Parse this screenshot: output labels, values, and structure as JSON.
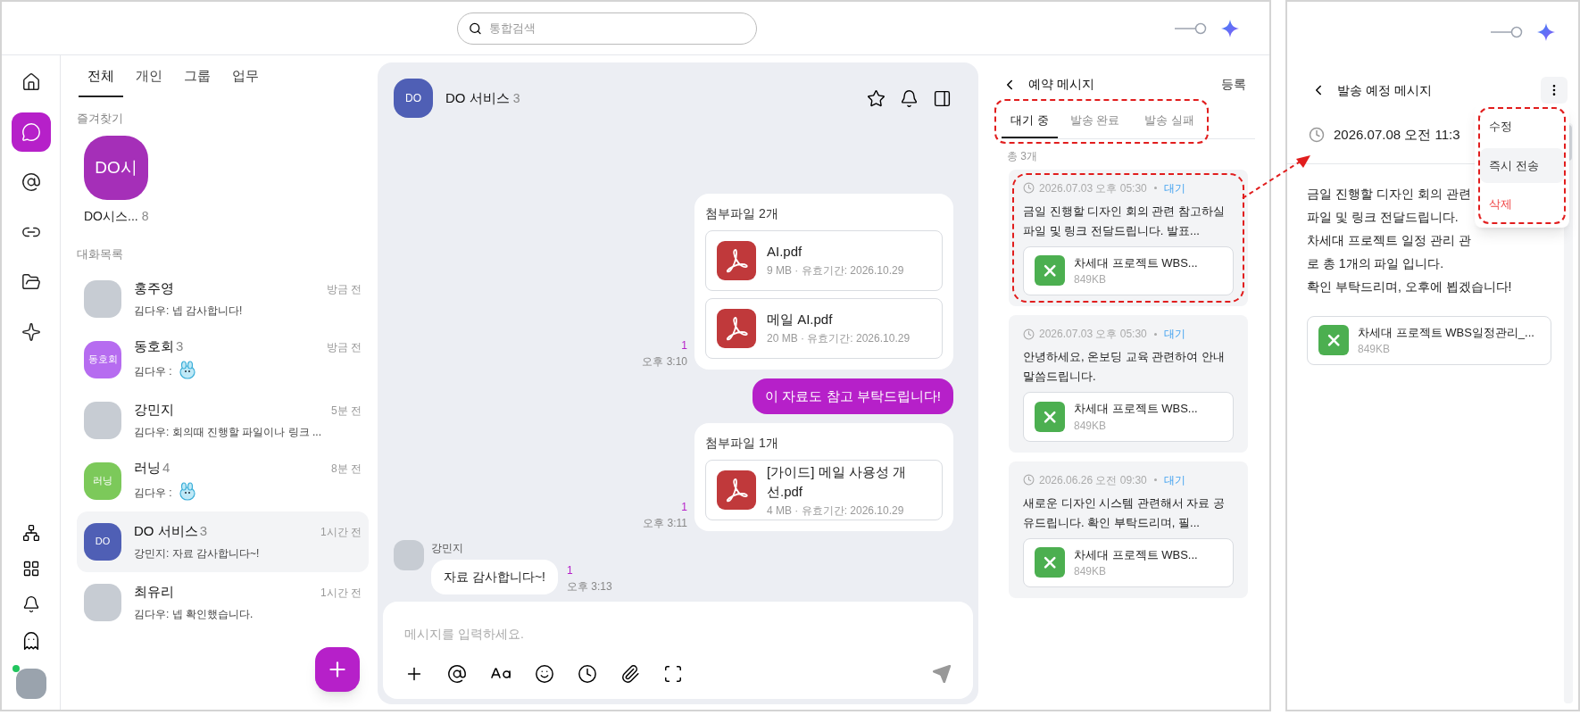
{
  "top_bar": {
    "search": {
      "placeholder": "통합검색"
    }
  },
  "nav": {
    "items": [
      {
        "selected": false
      },
      {
        "selected": true
      },
      {
        "selected": false
      },
      {
        "selected": false
      },
      {
        "selected": false
      },
      {
        "selected": false
      }
    ],
    "user": {
      "online": true
    }
  },
  "list": {
    "tabs": [
      {
        "label": "전체",
        "selected": true
      },
      {
        "label": "개인",
        "selected": false
      },
      {
        "label": "그룹",
        "selected": false
      },
      {
        "label": "업무",
        "selected": false
      }
    ],
    "favorites": {
      "heading": "즐겨찾기",
      "items": [
        {
          "avatar_text": "DO시",
          "color": "#a52fb8",
          "name": "DO시스...",
          "count": "8"
        }
      ]
    },
    "conversations": {
      "heading": "대화목록",
      "items": [
        {
          "kind": "photo",
          "name": "홍주영",
          "time": "방금 전",
          "preview": "김다우: 넵 감사합니다!",
          "sticker": false,
          "selected": false
        },
        {
          "kind": "initials",
          "avatar_text": "동호회",
          "color": "#b66cf0",
          "name": "동호회",
          "count": "3",
          "time": "방금 전",
          "preview": "김다우 :",
          "sticker": true,
          "selected": false
        },
        {
          "kind": "photo",
          "name": "강민지",
          "time": "5분 전",
          "preview": "김다우: 회의때 진행할 파일이나 링크 ...",
          "sticker": false,
          "selected": false
        },
        {
          "kind": "initials",
          "avatar_text": "러닝",
          "color": "#7cc95a",
          "name": "러닝",
          "count": "4",
          "time": "8분 전",
          "preview": "김다우 :",
          "sticker": true,
          "selected": false
        },
        {
          "kind": "initials",
          "avatar_text": "DO",
          "color": "#4f5fb5",
          "name": "DO 서비스",
          "count": "3",
          "time": "1시간 전",
          "preview": "강민지: 자료 감사합니다~!",
          "sticker": false,
          "selected": true
        },
        {
          "kind": "photo",
          "name": "최유리",
          "time": "1시간 전",
          "preview": "김다우: 넵 확인했습니다.",
          "sticker": false,
          "selected": false
        }
      ]
    }
  },
  "chat": {
    "header": {
      "avatar_text": "DO",
      "color": "#4f5fb5",
      "title": "DO 서비스",
      "count": "3"
    },
    "messages": [
      {
        "kind": "attachments",
        "title": "첨부파일 2개",
        "files": [
          {
            "name": "AI.pdf",
            "meta": "9 MB · 유효기간: 2026.10.29"
          },
          {
            "name": "메일 AI.pdf",
            "meta": "20 MB · 유효기간: 2026.10.29"
          }
        ],
        "unread": "1",
        "time": "오후 3:10"
      },
      {
        "kind": "text",
        "text": "이 자료도 참고 부탁드립니다!"
      },
      {
        "kind": "attachments",
        "title": "첨부파일 1개",
        "files": [
          {
            "name": "[가이드] 메일 사용성 개선.pdf",
            "meta": "4 MB · 유효기간: 2026.10.29"
          }
        ],
        "unread": "1",
        "time": "오후 3:11"
      },
      {
        "kind": "incoming",
        "sender": "강민지",
        "text": "자료 감사합니다~!",
        "unread": "1",
        "time": "오후 3:13"
      }
    ],
    "composer": {
      "placeholder": "메시지를 입력하세요."
    }
  },
  "scheduled": {
    "title": "예약 메시지",
    "action": "등록",
    "tabs_callout": true,
    "tabs": [
      {
        "label": "대기 중",
        "selected": true
      },
      {
        "label": "발송 완료",
        "selected": false
      },
      {
        "label": "발송 실패",
        "selected": false
      }
    ],
    "total": "총 3개",
    "items": [
      {
        "time": "2026.07.03 오후 05:30",
        "status": "대기",
        "text": "금일 진행할 디자인 회의 관련 참고하실 파일 및 링크 전달드립니다. 발표...",
        "file": {
          "name": "차세대 프로젝트 WBS...",
          "size": "849KB"
        },
        "callout": true
      },
      {
        "time": "2026.07.03 오후 05:30",
        "status": "대기",
        "text": "안녕하세요, 온보딩 교육 관련하여 안내말씀드립니다.",
        "file": {
          "name": "차세대 프로젝트 WBS...",
          "size": "849KB"
        },
        "callout": false
      },
      {
        "time": "2026.06.26 오전 09:30",
        "status": "대기",
        "text": "새로운 디자인 시스템 관련해서 자료 공유드립니다. 확인 부탁드리며, 필...",
        "file": {
          "name": "차세대 프로젝트 WBS...",
          "size": "849KB"
        },
        "callout": false
      }
    ]
  },
  "detail": {
    "title": "발송 예정 메시지",
    "time": "2026.07.08 오전 11:3",
    "lines": [
      "금일 진행할 디자인 회의 관련",
      "파일 및 링크 전달드립니다.",
      "차세대 프로젝트 일정 관리 관",
      "로 총 1개의 파일 입니다.",
      "확인 부탁드리며, 오후에 뵙겠습니다!"
    ],
    "file": {
      "name": "차세대 프로젝트 WBS일정관리_...",
      "size": "849KB"
    },
    "menu": {
      "callout": true,
      "items": [
        {
          "label": "수정",
          "highlighted": false,
          "danger": false
        },
        {
          "label": "즉시 전송",
          "highlighted": true,
          "danger": false
        },
        {
          "label": "삭제",
          "highlighted": false,
          "danger": true
        }
      ]
    }
  }
}
